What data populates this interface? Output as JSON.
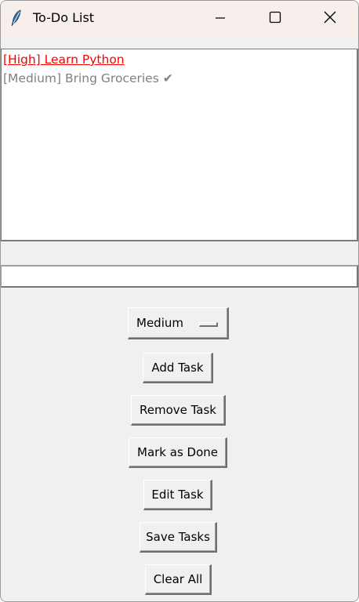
{
  "window": {
    "title": "To-Do List"
  },
  "tasks": {
    "items": [
      {
        "text": "[High] Learn Python",
        "color": "#ff0000"
      },
      {
        "text": "[Medium] Bring Groceries ✔",
        "color": "#808080"
      }
    ]
  },
  "entry": {
    "value": ""
  },
  "priority": {
    "selected": "Medium"
  },
  "buttons": {
    "add": "Add Task",
    "remove": "Remove Task",
    "done": "Mark as Done",
    "edit": "Edit Task",
    "save": "Save Tasks",
    "clear": "Clear All"
  },
  "icons": {
    "app": "feather-icon",
    "minimize": "minimize-icon",
    "maximize": "maximize-icon",
    "close": "close-icon"
  }
}
